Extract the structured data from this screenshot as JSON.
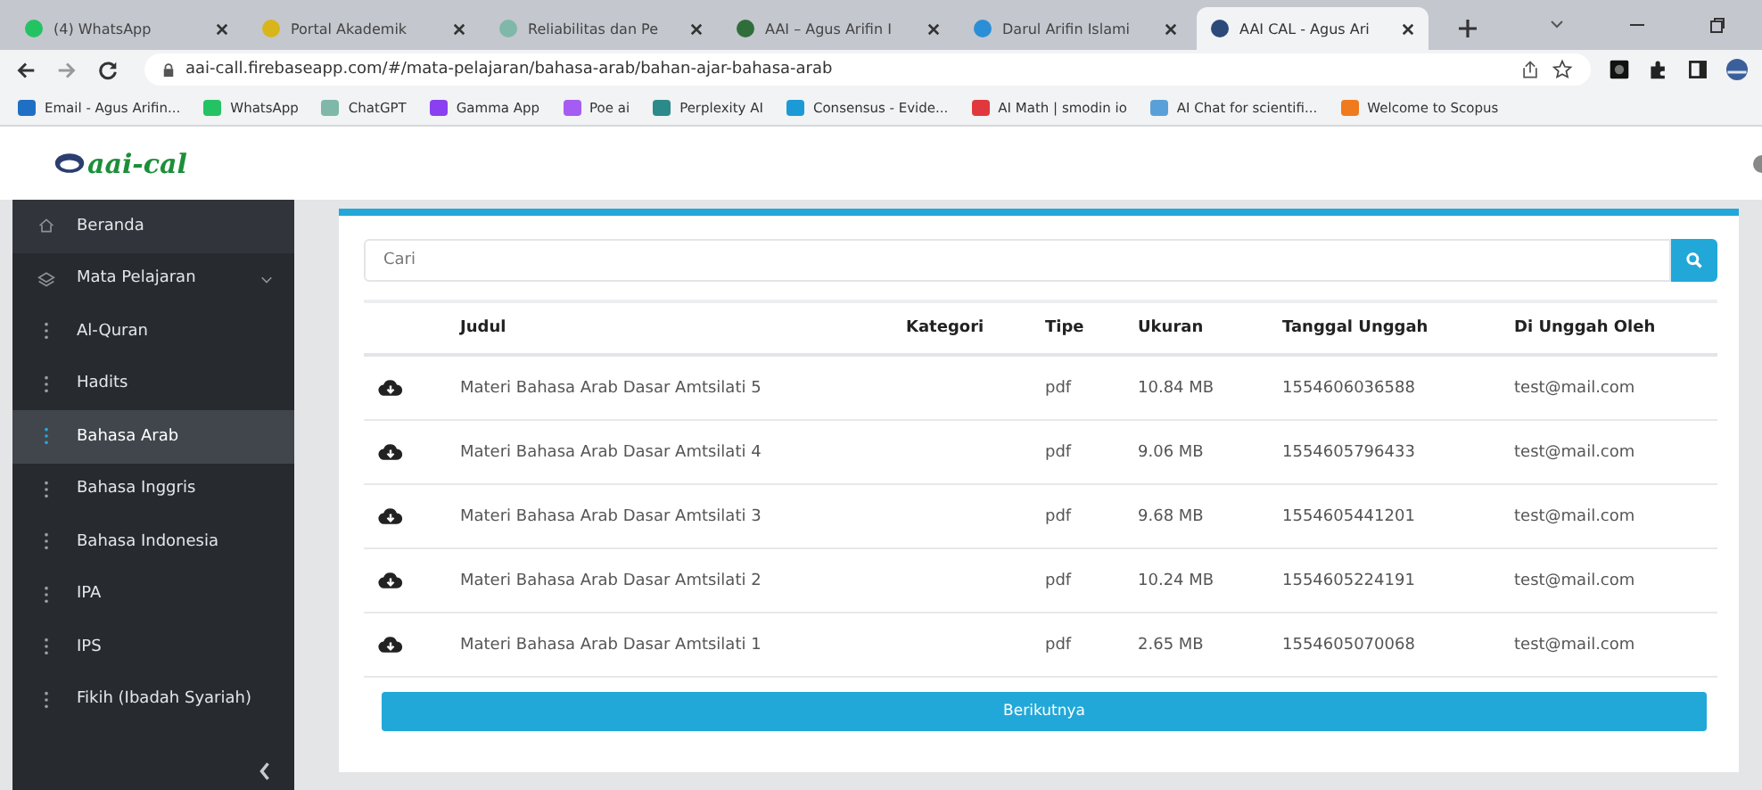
{
  "browser": {
    "tabs": [
      {
        "title": "(4) WhatsApp",
        "selected": false,
        "color": "#25c263"
      },
      {
        "title": "Portal Akademik",
        "selected": false,
        "color": "#d9b51c"
      },
      {
        "title": "Reliabilitas dan Pe",
        "selected": false,
        "color": "#7fb8a8"
      },
      {
        "title": "AAI – Agus Arifin I",
        "selected": false,
        "color": "#2f6e3a"
      },
      {
        "title": "Darul Arifin Islami",
        "selected": false,
        "color": "#2a8fd6"
      },
      {
        "title": "AAI CAL - Agus Ari",
        "selected": true,
        "color": "#2b4a7a"
      }
    ],
    "url": "aai-call.firebaseapp.com/#/mata-pelajaran/bahasa-arab/bahan-ajar-bahasa-arab",
    "bookmarks": [
      {
        "title": "Email - Agus Arifin...",
        "color": "#1f6fc4"
      },
      {
        "title": "WhatsApp",
        "color": "#25c263"
      },
      {
        "title": "ChatGPT",
        "color": "#7fb8a8"
      },
      {
        "title": "Gamma App",
        "color": "#8a3ff0"
      },
      {
        "title": "Poe ai",
        "color": "#a55cf2"
      },
      {
        "title": "Perplexity AI",
        "color": "#2d8a8a"
      },
      {
        "title": "Consensus - Evide...",
        "color": "#1c9ad6"
      },
      {
        "title": "AI Math | smodin io",
        "color": "#e0383c"
      },
      {
        "title": "AI Chat for scientifi...",
        "color": "#5aa0d8"
      },
      {
        "title": "Welcome to Scopus",
        "color": "#f07a1e"
      }
    ]
  },
  "app": {
    "logo": "aai-cal",
    "sidebar": {
      "items": [
        {
          "label": "Beranda",
          "kind": "home",
          "selected": false
        },
        {
          "label": "Mata Pelajaran",
          "kind": "group",
          "selected": false,
          "expanded": true,
          "children": [
            {
              "label": "Al-Quran",
              "selected": false
            },
            {
              "label": "Hadits",
              "selected": false
            },
            {
              "label": "Bahasa Arab",
              "selected": true
            },
            {
              "label": "Bahasa Inggris",
              "selected": false
            },
            {
              "label": "Bahasa Indonesia",
              "selected": false
            },
            {
              "label": "IPA",
              "selected": false
            },
            {
              "label": "IPS",
              "selected": false
            },
            {
              "label": "Fikih (Ibadah Syariah)",
              "selected": false
            }
          ]
        }
      ]
    },
    "search": {
      "placeholder": "Cari"
    },
    "table": {
      "columns": [
        "Judul",
        "Kategori",
        "Tipe",
        "Ukuran",
        "Tanggal Unggah",
        "Di Unggah Oleh"
      ],
      "rows": [
        {
          "judul": "Materi Bahasa Arab Dasar Amtsilati 5",
          "tipe": "pdf",
          "ukuran": "10.84 MB",
          "tanggal": "1554606036588",
          "oleh": "test@mail.com"
        },
        {
          "judul": "Materi Bahasa Arab Dasar Amtsilati 4",
          "tipe": "pdf",
          "ukuran": "9.06 MB",
          "tanggal": "1554605796433",
          "oleh": "test@mail.com"
        },
        {
          "judul": "Materi Bahasa Arab Dasar Amtsilati 3",
          "tipe": "pdf",
          "ukuran": "9.68 MB",
          "tanggal": "1554605441201",
          "oleh": "test@mail.com"
        },
        {
          "judul": "Materi Bahasa Arab Dasar Amtsilati 2",
          "tipe": "pdf",
          "ukuran": "10.24 MB",
          "tanggal": "1554605224191",
          "oleh": "test@mail.com"
        },
        {
          "judul": "Materi Bahasa Arab Dasar Amtsilati 1",
          "tipe": "pdf",
          "ukuran": "2.65 MB",
          "tanggal": "1554605070068",
          "oleh": "test@mail.com"
        }
      ]
    },
    "next_button": "Berikutnya"
  }
}
